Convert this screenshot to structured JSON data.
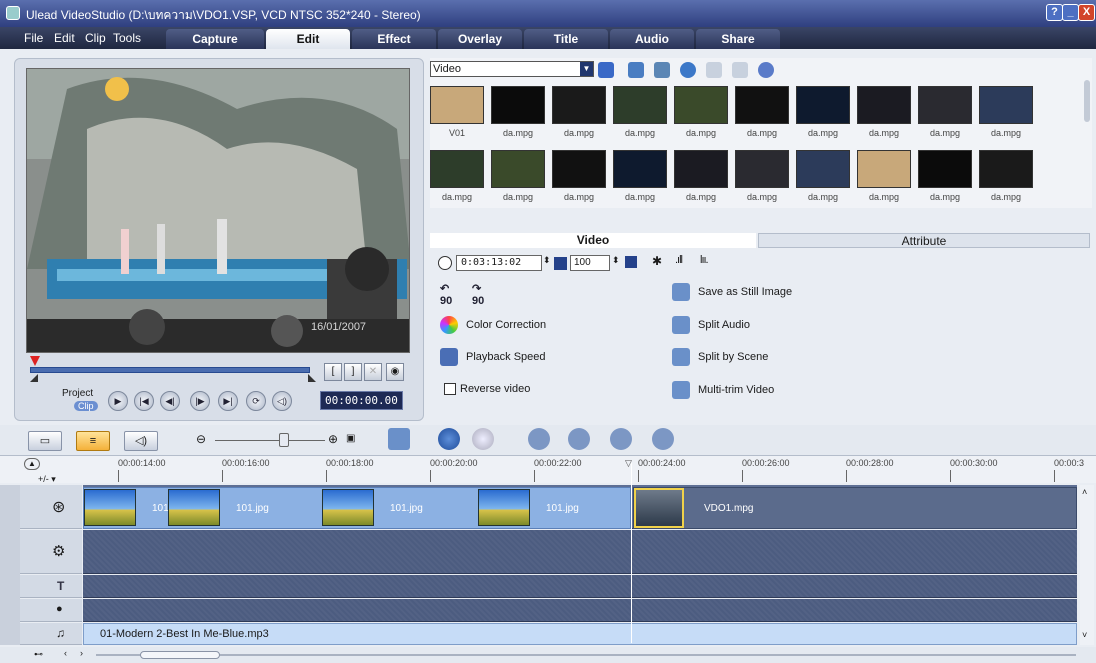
{
  "window": {
    "title": "Ulead VideoStudio (D:\\บทความ\\VDO1.VSP, VCD NTSC 352*240 - Stereo)",
    "controls": [
      "?",
      "_",
      "X"
    ]
  },
  "menu": [
    "File",
    "Edit",
    "Clip",
    "Tools"
  ],
  "tabs": [
    "Capture",
    "Edit",
    "Effect",
    "Overlay",
    "Title",
    "Audio",
    "Share"
  ],
  "active_tab": "Edit",
  "preview": {
    "timestamp_overlay": "16/01/2007",
    "mode_project": "Project",
    "mode_clip": "Clip",
    "timecode": "00:00:00.00",
    "trim_in": "[",
    "trim_out": "]"
  },
  "library": {
    "selected": "Video",
    "thumbnails_row1": [
      "V01",
      "da.mpg",
      "da.mpg",
      "da.mpg",
      "da.mpg",
      "da.mpg",
      "da.mpg",
      "da.mpg",
      "da.mpg",
      "da.mpg"
    ],
    "thumbnails_row2": [
      "da.mpg",
      "da.mpg",
      "da.mpg",
      "da.mpg",
      "da.mpg",
      "da.mpg",
      "da.mpg",
      "da.mpg",
      "da.mpg",
      "da.mpg"
    ]
  },
  "options": {
    "tab_video": "Video",
    "tab_attribute": "Attribute",
    "duration": "0:03:13:02",
    "volume": "100",
    "rotate_left": "90",
    "rotate_right": "90",
    "color_correction": "Color Correction",
    "playback_speed": "Playback Speed",
    "reverse_video": "Reverse video",
    "save_still": "Save as Still Image",
    "split_audio": "Split Audio",
    "split_by_scene": "Split by Scene",
    "multi_trim": "Multi-trim Video"
  },
  "timeline": {
    "ticks": [
      "00:00:14:00",
      "00:00:16:00",
      "00:00:18:00",
      "00:00:20:00",
      "00:00:22:00",
      "00:00:24:00",
      "00:00:26:00",
      "00:00:28:00",
      "00:00:30:00",
      "00:00:3"
    ],
    "ruler_zoom": "+/- ▾",
    "clip_labels": [
      "101",
      "101.jpg",
      "101.jpg",
      "101.jpg"
    ],
    "video_clip": "VDO1.mpg",
    "music": "01-Modern 2-Best In Me-Blue.mp3",
    "track_icons": {
      "title": "T",
      "music": "♫"
    }
  },
  "colors": {
    "accent": "#2f3f7f",
    "timeline_track": "#4c5c80",
    "clip_blue": "#8cb1e3"
  }
}
